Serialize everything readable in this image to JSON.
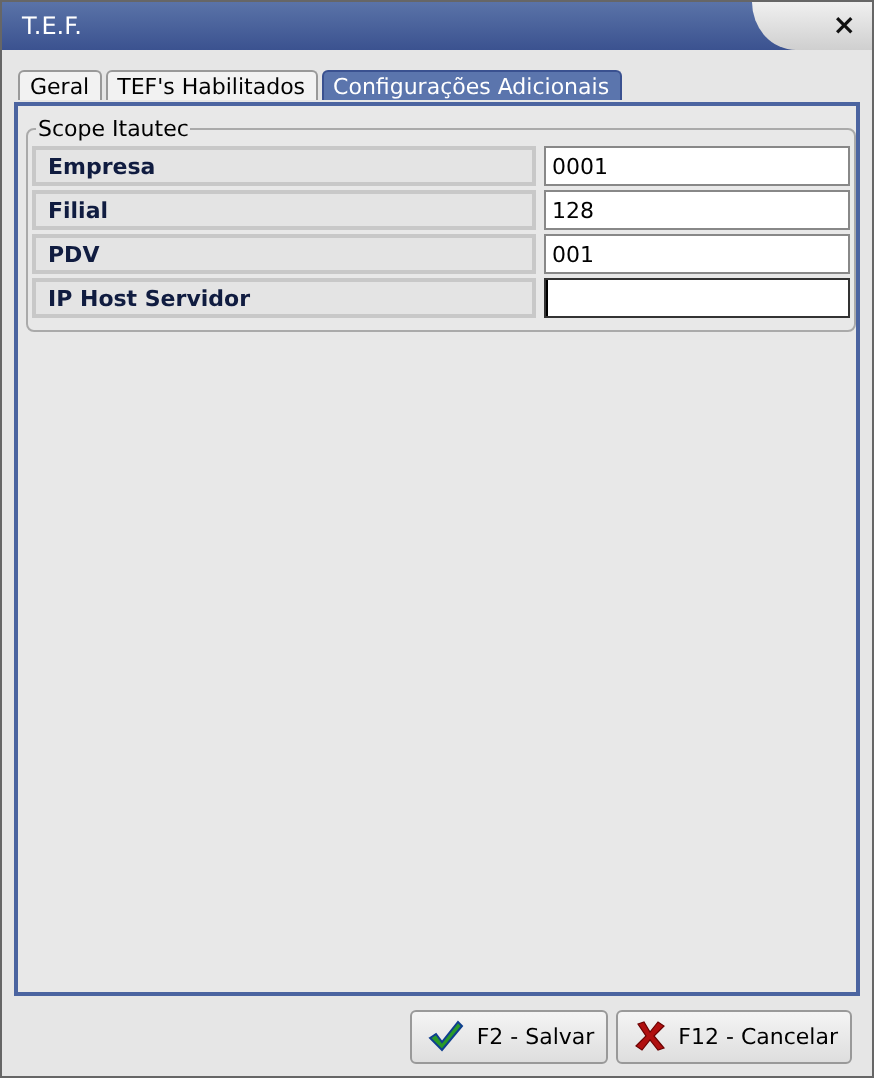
{
  "window": {
    "title": "T.E.F.",
    "close": "×"
  },
  "tabs": [
    {
      "label": "Geral",
      "selected": false
    },
    {
      "label": "TEF's Habilitados",
      "selected": false
    },
    {
      "label": "Configurações Adicionais",
      "selected": true
    }
  ],
  "group": {
    "title": "Scope Itautec",
    "fields": [
      {
        "label": "Empresa",
        "value": "0001"
      },
      {
        "label": "Filial",
        "value": "128"
      },
      {
        "label": "PDV",
        "value": "001"
      },
      {
        "label": "IP Host Servidor",
        "focused": true
      }
    ]
  },
  "buttons": [
    {
      "kind": "save",
      "label": "F2 - Salvar"
    },
    {
      "kind": "cancel",
      "label": "F12 - Cancelar"
    }
  ]
}
